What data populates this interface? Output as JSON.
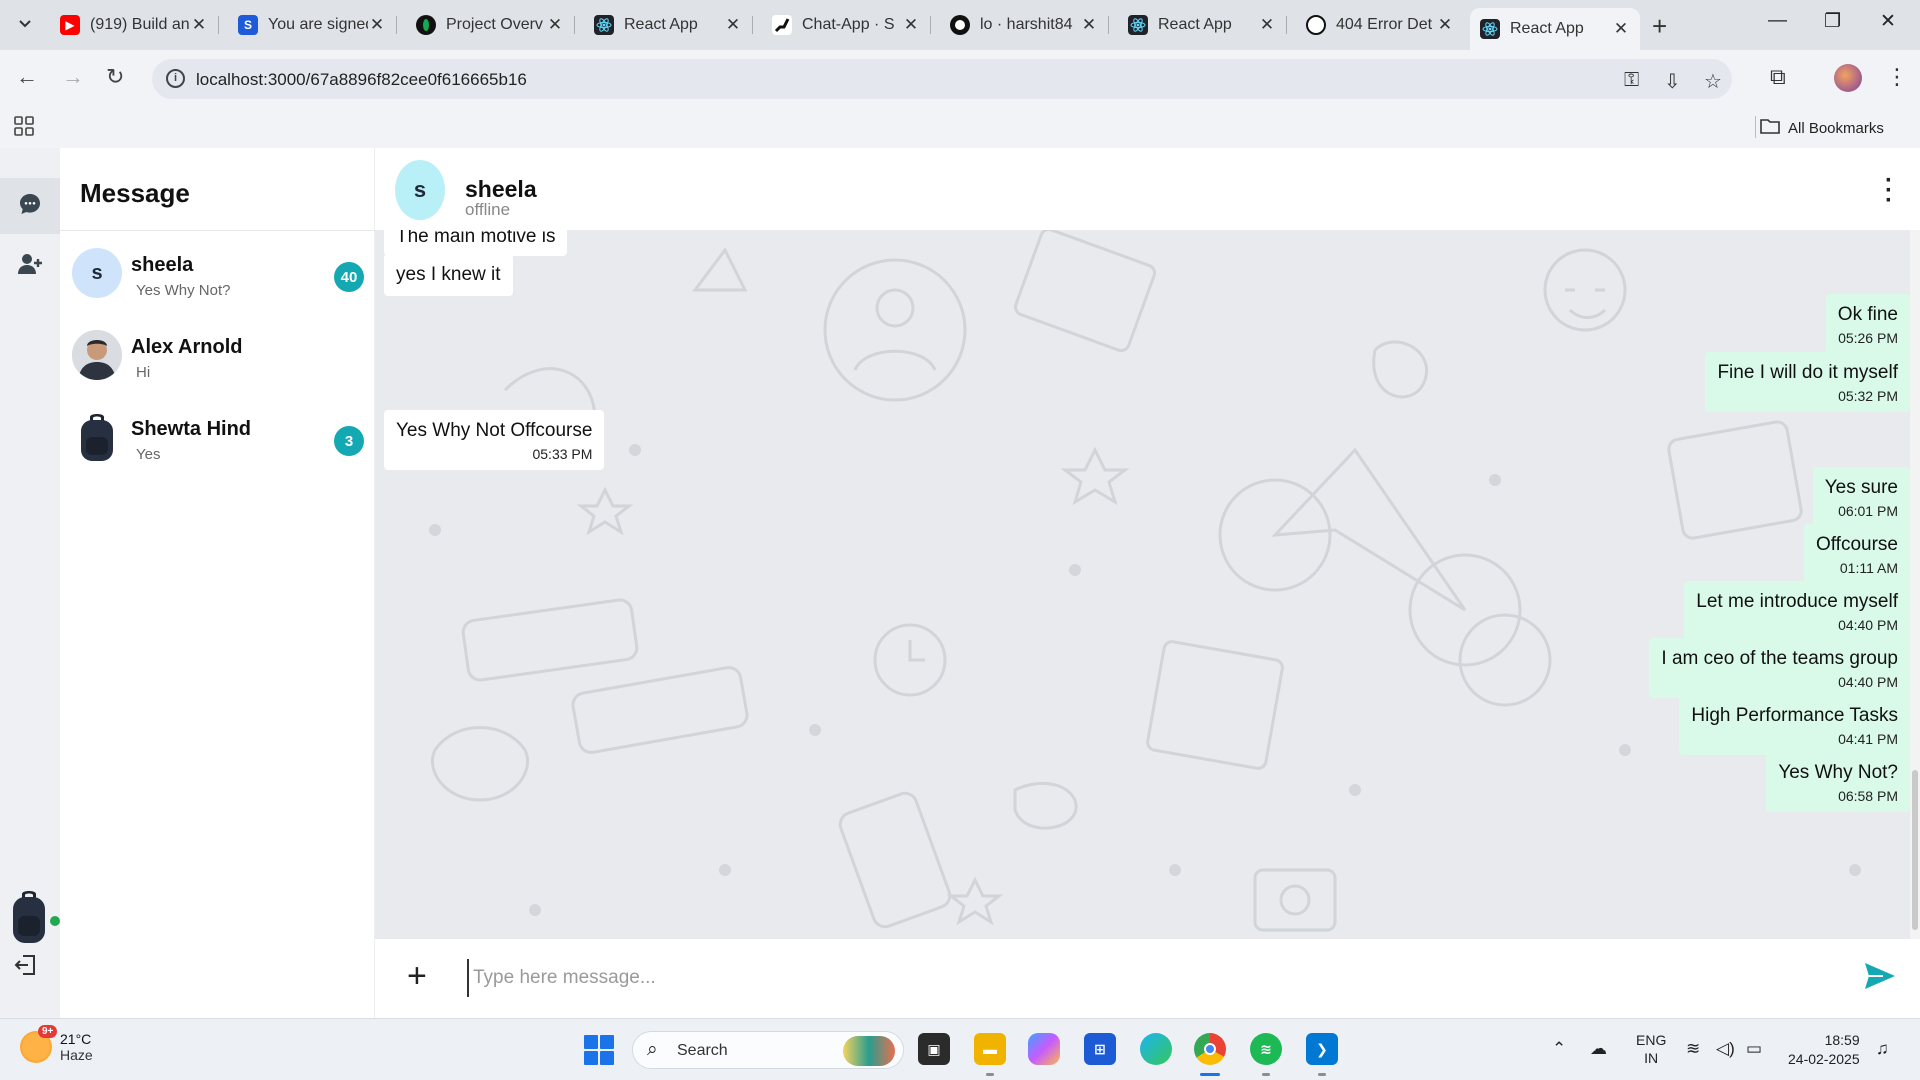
{
  "browser": {
    "tabs": [
      {
        "title": "(919) Build an",
        "icon": "youtube-icon",
        "color": "#ff0000"
      },
      {
        "title": "You are signed",
        "icon": "s-logo-icon",
        "color": "#1e5bd8"
      },
      {
        "title": "Project Overv",
        "icon": "mongodb-leaf-icon",
        "color": "#13aa52"
      },
      {
        "title": "React App",
        "icon": "react-icon",
        "color": "#20232a"
      },
      {
        "title": "Chat-App · S",
        "icon": "link-icon",
        "color": "#111111"
      },
      {
        "title": "lo · harshit84",
        "icon": "github-icon",
        "color": "#111111"
      },
      {
        "title": "React App",
        "icon": "react-icon",
        "color": "#20232a"
      },
      {
        "title": "404 Error Det",
        "icon": "openai-icon",
        "color": "#111111"
      },
      {
        "title": "React App",
        "icon": "react-icon",
        "color": "#20232a"
      }
    ],
    "active_tab_index": 8,
    "url": "localhost:3000/67a8896f82cee0f616665b16",
    "bookmarks_label": "All Bookmarks"
  },
  "sidebar": {
    "title": "Message",
    "contacts": [
      {
        "initial": "s",
        "name": "sheela",
        "last_message": "Yes Why Not?",
        "unread": "40",
        "avatar_color": "#cfe3fb"
      },
      {
        "initial": "",
        "name": "Alex Arnold",
        "last_message": "Hi",
        "unread": "",
        "avatar_color": "#cfd4da"
      },
      {
        "initial": "",
        "name": "Shewta Hind",
        "last_message": "Yes",
        "unread": "3",
        "avatar_color": "#ffffff"
      }
    ]
  },
  "chat": {
    "contact_initial": "s",
    "contact_name": "sheela",
    "contact_status": "offline",
    "messages": [
      {
        "dir": "in",
        "text": "The main motive is",
        "time": ""
      },
      {
        "dir": "in",
        "text": "yes I knew it",
        "time": ""
      },
      {
        "dir": "out",
        "text": "Ok fine",
        "time": "05:26 PM"
      },
      {
        "dir": "out",
        "text": "Fine I will do it myself",
        "time": "05:32 PM"
      },
      {
        "dir": "in",
        "text": "Yes Why Not Offcourse",
        "time": "05:33 PM"
      },
      {
        "dir": "out",
        "text": "Yes sure",
        "time": "06:01 PM"
      },
      {
        "dir": "out",
        "text": "Offcourse",
        "time": "01:11 AM"
      },
      {
        "dir": "out",
        "text": "Let me introduce myself",
        "time": "04:40 PM"
      },
      {
        "dir": "out",
        "text": "I am ceo of the teams group",
        "time": "04:40 PM"
      },
      {
        "dir": "out",
        "text": "High Performance Tasks",
        "time": "04:41 PM"
      },
      {
        "dir": "out",
        "text": "Yes Why Not?",
        "time": "06:58 PM"
      }
    ],
    "input_placeholder": "Type here message...",
    "accent_color": "#14a9b2",
    "outgoing_bubble_color": "#d9fae9"
  },
  "taskbar": {
    "weather_temp": "21°C",
    "weather_desc": "Haze",
    "weather_badge": "9+",
    "search_label": "Search",
    "lang_line1": "ENG",
    "lang_line2": "IN",
    "time": "18:59",
    "date": "24-02-2025"
  }
}
